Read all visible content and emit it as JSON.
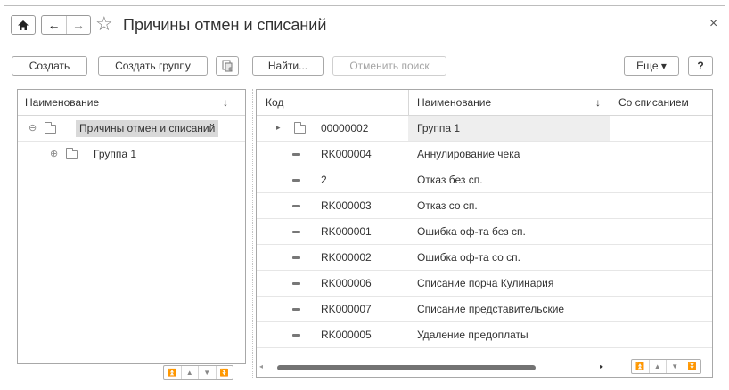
{
  "header": {
    "title": "Причины отмен и списаний",
    "home_icon": "home-icon",
    "back_icon": "arrow-left-icon",
    "forward_icon": "arrow-right-icon",
    "favorite_icon": "star-icon",
    "close_glyph": "×"
  },
  "toolbar": {
    "create_label": "Создать",
    "create_group_label": "Создать группу",
    "copy_icon": "copy-icon",
    "find_label": "Найти...",
    "cancel_search_label": "Отменить поиск",
    "more_label": "Еще ▾",
    "help_label": "?"
  },
  "tree": {
    "header": "Наименование",
    "sort_indicator": "↓",
    "items": [
      {
        "label": "Причины отмен и списаний",
        "toggle": "⊖",
        "selected": true
      },
      {
        "label": "Группа 1",
        "toggle": "⊕",
        "selected": false
      }
    ]
  },
  "list": {
    "columns": {
      "code": "Код",
      "name": "Наименование",
      "sort_indicator": "↓",
      "writeoff": "Со списанием"
    },
    "rows": [
      {
        "code": "00000002",
        "name": "Группа 1",
        "writeoff": "",
        "kind": "group"
      },
      {
        "code": "RK000004",
        "name": "Аннулирование чека",
        "writeoff": "",
        "kind": "item"
      },
      {
        "code": "2",
        "name": "Отказ без сп.",
        "writeoff": "",
        "kind": "item"
      },
      {
        "code": "RK000003",
        "name": "Отказ со сп.",
        "writeoff": "",
        "kind": "item"
      },
      {
        "code": "RK000001",
        "name": "Ошибка оф-та без сп.",
        "writeoff": "",
        "kind": "item"
      },
      {
        "code": "RK000002",
        "name": "Ошибка оф-та со сп.",
        "writeoff": "",
        "kind": "item"
      },
      {
        "code": "RK000006",
        "name": "Списание порча Кулинария",
        "writeoff": "",
        "kind": "item"
      },
      {
        "code": "RK000007",
        "name": "Списание представительские",
        "writeoff": "",
        "kind": "item"
      },
      {
        "code": "RK000005",
        "name": "Удаление предоплаты",
        "writeoff": "",
        "kind": "item"
      }
    ]
  },
  "colors": {
    "border": "#a8a8a8",
    "selection": "#d9d9d9",
    "row_highlight": "#eeeeee",
    "text": "#333333"
  }
}
